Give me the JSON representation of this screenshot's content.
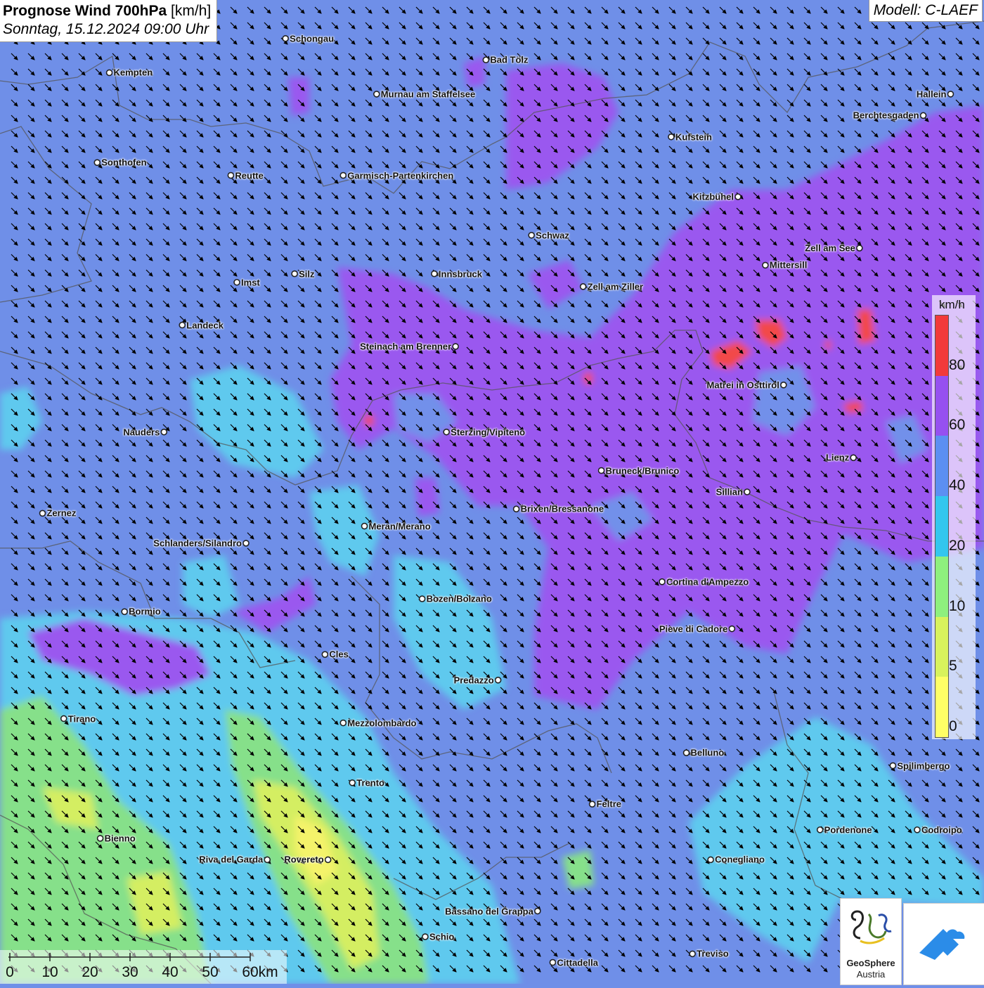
{
  "header": {
    "title_bold": "Prognose Wind 700hPa",
    "title_unit": "[km/h]",
    "datetime": "Sonntag, 15.12.2024 09:00 Uhr",
    "model": "Modell: C-LAEF"
  },
  "legend": {
    "unit": "km/h",
    "labels": [
      "80",
      "60",
      "40",
      "20",
      "10",
      "5",
      "0"
    ],
    "colors": [
      "#f23a3a",
      "#9650f0",
      "#5c8ff2",
      "#33c6ee",
      "#8ef07e",
      "#d8f25c",
      "#ffff66"
    ]
  },
  "scalebar": {
    "labels": [
      "0",
      "10",
      "20",
      "30",
      "40",
      "50",
      "60km"
    ]
  },
  "logo": {
    "name_line1": "GeoSphere",
    "name_line2": "Austria"
  },
  "cities": [
    {
      "name": "Schongau",
      "lon": 10.9,
      "lat": 47.81,
      "label_side": "right"
    },
    {
      "name": "Bad Tölz",
      "lon": 11.56,
      "lat": 47.76,
      "label_side": "right"
    },
    {
      "name": "Kempten",
      "lon": 10.32,
      "lat": 47.73,
      "label_side": "right"
    },
    {
      "name": "Murnau am Staffelsee",
      "lon": 11.2,
      "lat": 47.68,
      "label_side": "right"
    },
    {
      "name": "Hallein",
      "lon": 13.09,
      "lat": 47.68,
      "label_side": "left"
    },
    {
      "name": "Berchtesgaden",
      "lon": 13.0,
      "lat": 47.63,
      "label_side": "left"
    },
    {
      "name": "Kufstein",
      "lon": 12.17,
      "lat": 47.58,
      "label_side": "right"
    },
    {
      "name": "Sonthofen",
      "lon": 10.28,
      "lat": 47.52,
      "label_side": "right"
    },
    {
      "name": "Reutte",
      "lon": 10.72,
      "lat": 47.49,
      "label_side": "right"
    },
    {
      "name": "Garmisch-Partenkirchen",
      "lon": 11.09,
      "lat": 47.49,
      "label_side": "right"
    },
    {
      "name": "Kitzbühel",
      "lon": 12.39,
      "lat": 47.44,
      "label_side": "left"
    },
    {
      "name": "Schwaz",
      "lon": 11.71,
      "lat": 47.35,
      "label_side": "right"
    },
    {
      "name": "Zell am See",
      "lon": 12.79,
      "lat": 47.32,
      "label_side": "left"
    },
    {
      "name": "Mittersill",
      "lon": 12.48,
      "lat": 47.28,
      "label_side": "right"
    },
    {
      "name": "Innsbruck",
      "lon": 11.39,
      "lat": 47.26,
      "label_side": "right"
    },
    {
      "name": "Silz",
      "lon": 10.93,
      "lat": 47.26,
      "label_side": "right"
    },
    {
      "name": "Imst",
      "lon": 10.74,
      "lat": 47.24,
      "label_side": "right"
    },
    {
      "name": "Zell am Ziller",
      "lon": 11.88,
      "lat": 47.23,
      "label_side": "right"
    },
    {
      "name": "Landeck",
      "lon": 10.56,
      "lat": 47.14,
      "label_side": "right"
    },
    {
      "name": "Steinach am Brenner",
      "lon": 11.46,
      "lat": 47.09,
      "label_side": "left"
    },
    {
      "name": "Matrei in Osttirol",
      "lon": 12.54,
      "lat": 47.0,
      "label_side": "left"
    },
    {
      "name": "Nauders",
      "lon": 10.5,
      "lat": 46.89,
      "label_side": "left"
    },
    {
      "name": "Sterzing/Vipiteno",
      "lon": 11.43,
      "lat": 46.89,
      "label_side": "right"
    },
    {
      "name": "Lienz",
      "lon": 12.77,
      "lat": 46.83,
      "label_side": "left"
    },
    {
      "name": "Bruneck/Brunico",
      "lon": 11.94,
      "lat": 46.8,
      "label_side": "right"
    },
    {
      "name": "Sillian",
      "lon": 12.42,
      "lat": 46.75,
      "label_side": "left"
    },
    {
      "name": "Zernez",
      "lon": 10.1,
      "lat": 46.7,
      "label_side": "right"
    },
    {
      "name": "Brixen/Bressanone",
      "lon": 11.66,
      "lat": 46.71,
      "label_side": "right"
    },
    {
      "name": "Meran/Merano",
      "lon": 11.16,
      "lat": 46.67,
      "label_side": "right"
    },
    {
      "name": "Schlanders/Silandro",
      "lon": 10.77,
      "lat": 46.63,
      "label_side": "left"
    },
    {
      "name": "Cortina d'Ampezzo",
      "lon": 12.14,
      "lat": 46.54,
      "label_side": "right"
    },
    {
      "name": "Bozen/Bolzano",
      "lon": 11.35,
      "lat": 46.5,
      "label_side": "right"
    },
    {
      "name": "Bormio",
      "lon": 10.37,
      "lat": 46.47,
      "label_side": "right"
    },
    {
      "name": "Pieve di Cadore",
      "lon": 12.37,
      "lat": 46.43,
      "label_side": "left"
    },
    {
      "name": "Cles",
      "lon": 11.03,
      "lat": 46.37,
      "label_side": "right"
    },
    {
      "name": "Predazzo",
      "lon": 11.6,
      "lat": 46.31,
      "label_side": "left"
    },
    {
      "name": "Tirano",
      "lon": 10.17,
      "lat": 46.22,
      "label_side": "right"
    },
    {
      "name": "Mezzolombardo",
      "lon": 11.09,
      "lat": 46.21,
      "label_side": "right"
    },
    {
      "name": "Belluno",
      "lon": 12.22,
      "lat": 46.14,
      "label_side": "right"
    },
    {
      "name": "Spilimbergo",
      "lon": 12.9,
      "lat": 46.11,
      "label_side": "right"
    },
    {
      "name": "Trento",
      "lon": 11.12,
      "lat": 46.07,
      "label_side": "right"
    },
    {
      "name": "Feltre",
      "lon": 11.91,
      "lat": 46.02,
      "label_side": "right"
    },
    {
      "name": "Pordenone",
      "lon": 12.66,
      "lat": 45.96,
      "label_side": "right"
    },
    {
      "name": "Codroipo",
      "lon": 12.98,
      "lat": 45.96,
      "label_side": "right"
    },
    {
      "name": "Bienno",
      "lon": 10.29,
      "lat": 45.94,
      "label_side": "right"
    },
    {
      "name": "Riva del Garda",
      "lon": 10.84,
      "lat": 45.89,
      "label_side": "left"
    },
    {
      "name": "Rovereto",
      "lon": 11.04,
      "lat": 45.89,
      "label_side": "left"
    },
    {
      "name": "Conegliano",
      "lon": 12.3,
      "lat": 45.89,
      "label_side": "right"
    },
    {
      "name": "Bassano del Grappa",
      "lon": 11.73,
      "lat": 45.77,
      "label_side": "left"
    },
    {
      "name": "Schio",
      "lon": 11.36,
      "lat": 45.71,
      "label_side": "right"
    },
    {
      "name": "Treviso",
      "lon": 12.24,
      "lat": 45.67,
      "label_side": "right"
    },
    {
      "name": "Cittadella",
      "lon": 11.78,
      "lat": 45.65,
      "label_side": "right"
    }
  ]
}
